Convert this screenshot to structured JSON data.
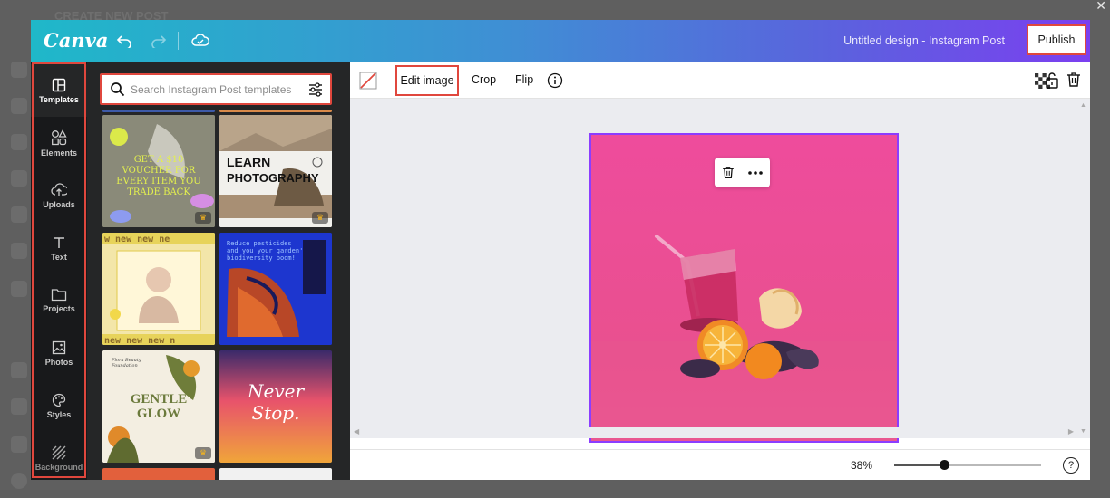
{
  "app": {
    "logo": "Canva",
    "design_title": "Untitled design - Instagram Post",
    "publish_label": "Publish",
    "background_title": "CREATE NEW POST"
  },
  "sidebar": {
    "items": [
      {
        "label": "Templates",
        "icon": "templates-icon"
      },
      {
        "label": "Elements",
        "icon": "elements-icon"
      },
      {
        "label": "Uploads",
        "icon": "upload-icon"
      },
      {
        "label": "Text",
        "icon": "text-icon"
      },
      {
        "label": "Projects",
        "icon": "folder-icon"
      },
      {
        "label": "Photos",
        "icon": "image-icon"
      },
      {
        "label": "Styles",
        "icon": "palette-icon"
      },
      {
        "label": "Background",
        "icon": "background-icon"
      }
    ]
  },
  "search": {
    "placeholder": "Search Instagram Post templates"
  },
  "templates": [
    {
      "name": "voucher",
      "text": "GET A $10 VOUCHER FOR EVERY ITEM YOU TRADE BACK"
    },
    {
      "name": "learn-photography",
      "text": "LEARN PHOTOGRAPHY"
    },
    {
      "name": "new-new",
      "text": "new new new"
    },
    {
      "name": "biodiversity",
      "text": "Reduce pesticides and you your garden's biodiversity boom!"
    },
    {
      "name": "gentle-glow",
      "text": "GENTLE GLOW",
      "sub": "Flora Beauty Foundation"
    },
    {
      "name": "never-stop",
      "text": "Never Stop."
    }
  ],
  "toolbar": {
    "edit_image": "Edit image",
    "crop": "Crop",
    "flip": "Flip"
  },
  "status": {
    "zoom": "38%",
    "help": "?"
  },
  "colors": {
    "accent_highlight": "#e0473d",
    "selection": "#8b3dff",
    "canvas_bg": "#ea4f96"
  }
}
